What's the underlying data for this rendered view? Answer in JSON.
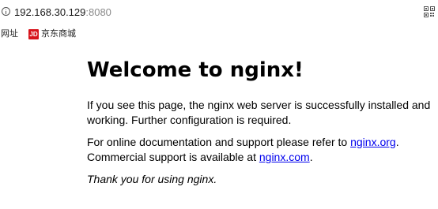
{
  "address_bar": {
    "host": "192.168.30.129",
    "port": ":8080",
    "info_icon": "info-icon",
    "qr_icon": "qr-code-icon"
  },
  "bookmarks_bar": {
    "items": [
      {
        "label": "用网址"
      },
      {
        "label": "京东商城",
        "icon": "JD"
      }
    ]
  },
  "page": {
    "title": "Welcome to nginx!",
    "p1_line1": "If you see this page, the nginx web server is successfully installed and",
    "p1_line2": "working. Further configuration is required.",
    "p2_line1_prefix": "For online documentation and support please refer to ",
    "p2_link1": "nginx.org",
    "p2_line1_suffix": ".",
    "p2_line2_prefix": "Commercial support is available at ",
    "p2_link2": "nginx.com",
    "p2_line2_suffix": ".",
    "p3": "Thank you for using nginx.",
    "link_color": "#0000ee"
  }
}
